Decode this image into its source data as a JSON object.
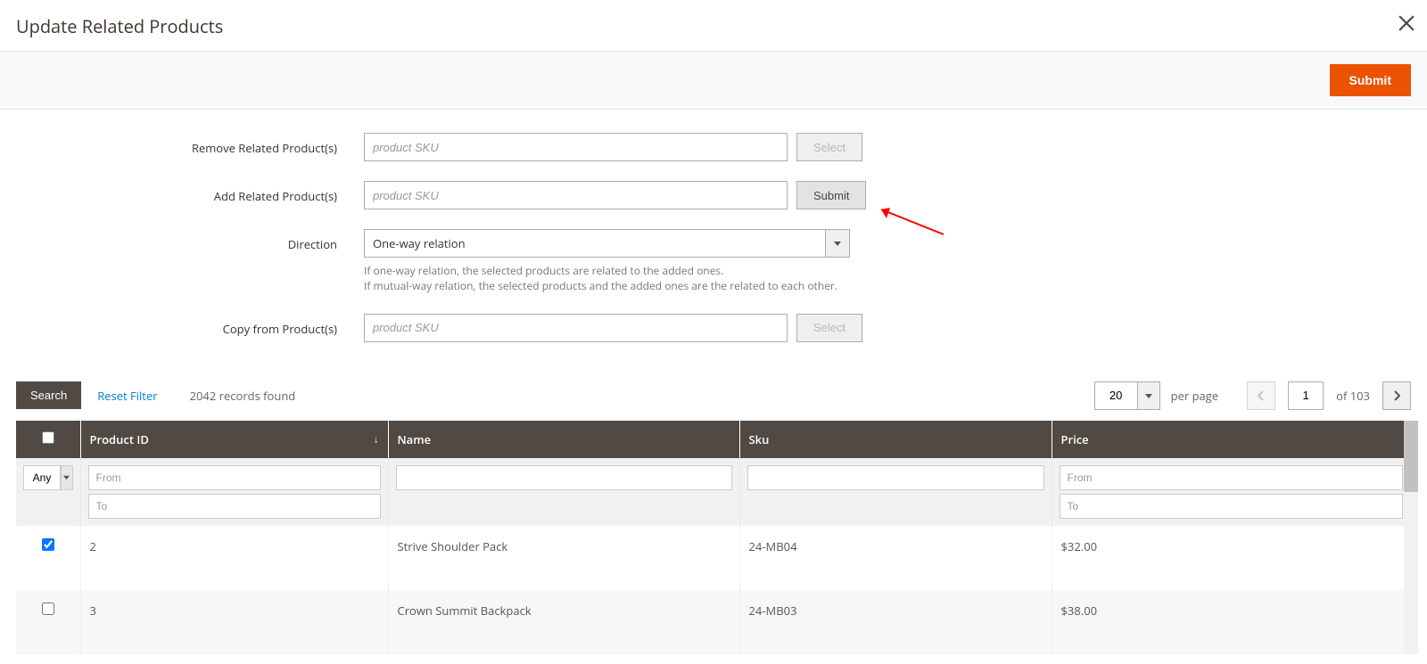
{
  "title": "Update Related Products",
  "submit_label": "Submit",
  "form": {
    "remove_label": "Remove Related Product(s)",
    "remove_placeholder": "product SKU",
    "remove_button": "Select",
    "add_label": "Add Related Product(s)",
    "add_placeholder": "product SKU",
    "add_button": "Submit",
    "direction_label": "Direction",
    "direction_value": "One-way relation",
    "direction_help_1": "If one-way relation, the selected products are related to the added ones.",
    "direction_help_2": "If mutual-way relation, the selected products and the added ones are the related to each other.",
    "copy_label": "Copy from Product(s)",
    "copy_placeholder": "product SKU",
    "copy_button": "Select"
  },
  "grid": {
    "search_label": "Search",
    "reset_label": "Reset Filter",
    "records_found": "2042 records found",
    "per_page_value": "20",
    "per_page_label": "per page",
    "page_value": "1",
    "page_of": "of 103",
    "columns": {
      "cb_filter": "Any",
      "product_id": "Product ID",
      "name": "Name",
      "sku": "Sku",
      "price": "Price",
      "from_ph": "From",
      "to_ph": "To"
    },
    "rows": [
      {
        "checked": true,
        "id": "2",
        "name": "Strive Shoulder Pack",
        "sku": "24-MB04",
        "price": "$32.00"
      },
      {
        "checked": false,
        "id": "3",
        "name": "Crown Summit Backpack",
        "sku": "24-MB03",
        "price": "$38.00"
      }
    ]
  }
}
